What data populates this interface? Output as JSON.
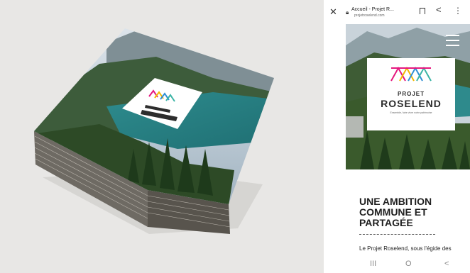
{
  "browser": {
    "close_icon": "close-icon",
    "title": "Accueil - Projet R...",
    "url": "projetroselend.com",
    "bookmark_icon": "bookmark-icon",
    "share_icon": "share-icon",
    "more_icon": "more-vertical-icon"
  },
  "hero": {
    "menu_icon": "hamburger-menu-icon",
    "logo_line1": "PROJET",
    "logo_line2": "ROSELEND",
    "logo_tagline": "Ensemble, faire vivre notre patrimoine",
    "logo_colors": [
      "#e5177e",
      "#f4b700",
      "#2f8fd4",
      "#3bb4a5"
    ]
  },
  "content": {
    "heading_line1": "UNE AMBITION",
    "heading_line2": "COMMUNE ET",
    "heading_line3": "PARTAGÉE",
    "body_text": "Le Projet Roselend, sous l'égide des"
  },
  "navbar": {
    "recents": "III",
    "home": "O",
    "back": "<"
  }
}
